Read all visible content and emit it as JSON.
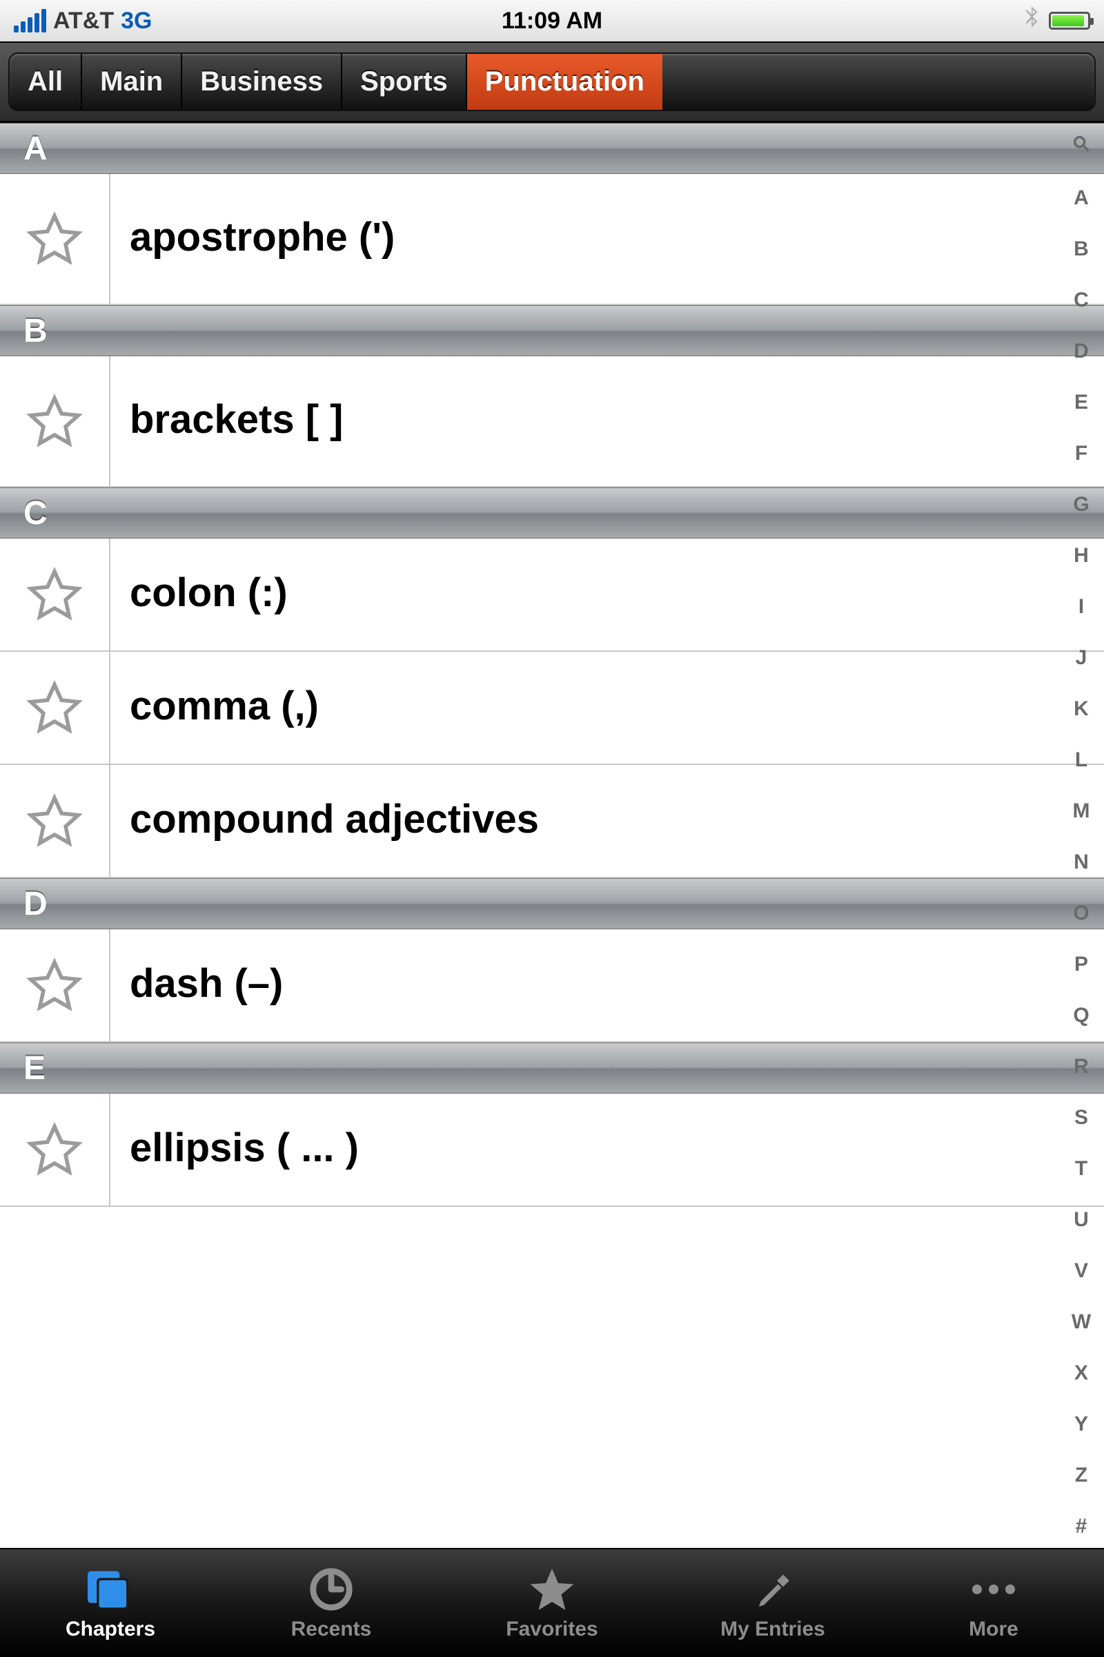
{
  "status": {
    "carrier": "AT&T",
    "network": "3G",
    "time": "11:09 AM"
  },
  "segments": {
    "items": [
      "All",
      "Main",
      "Business",
      "Sports",
      "Punctuation"
    ],
    "active_index": 4
  },
  "sections": [
    {
      "letter": "A",
      "rows": [
        {
          "label": "apostrophe (')"
        }
      ]
    },
    {
      "letter": "B",
      "rows": [
        {
          "label": "brackets [ ]"
        }
      ]
    },
    {
      "letter": "C",
      "rows": [
        {
          "label": "colon (:)"
        },
        {
          "label": "comma (,)"
        },
        {
          "label": "compound adjectives"
        }
      ]
    },
    {
      "letter": "D",
      "rows": [
        {
          "label": "dash (–)"
        }
      ]
    },
    {
      "letter": "E",
      "rows": [
        {
          "label": "ellipsis ( ... )"
        }
      ]
    }
  ],
  "index_letters": [
    "A",
    "B",
    "C",
    "D",
    "E",
    "F",
    "G",
    "H",
    "I",
    "J",
    "K",
    "L",
    "M",
    "N",
    "O",
    "P",
    "Q",
    "R",
    "S",
    "T",
    "U",
    "V",
    "W",
    "X",
    "Y",
    "Z",
    "#"
  ],
  "tabs": {
    "items": [
      "Chapters",
      "Recents",
      "Favorites",
      "My Entries",
      "More"
    ],
    "active_index": 0
  }
}
